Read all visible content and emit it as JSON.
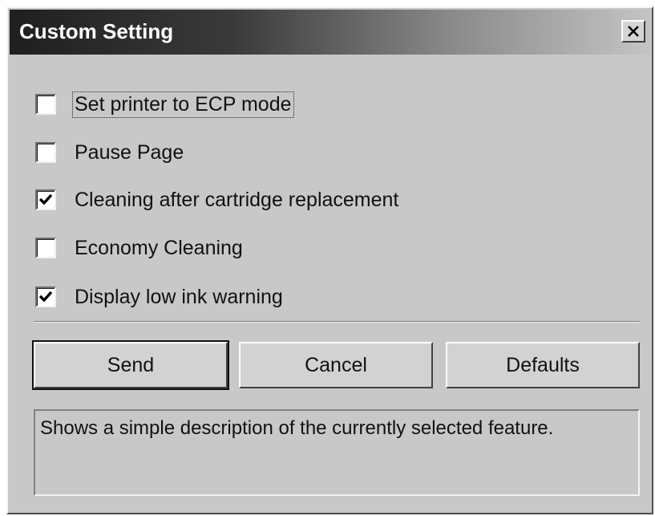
{
  "window": {
    "title": "Custom Setting",
    "close_label": "close"
  },
  "options": [
    {
      "label": "Set printer to ECP mode",
      "checked": false
    },
    {
      "label": "Pause Page",
      "checked": false
    },
    {
      "label": "Cleaning after cartridge replacement",
      "checked": true
    },
    {
      "label": "Economy Cleaning",
      "checked": false
    },
    {
      "label": "Display low ink warning",
      "checked": true
    }
  ],
  "buttons": {
    "send": "Send",
    "cancel": "Cancel",
    "defaults": "Defaults"
  },
  "description": "Shows a simple description of the currently selected feature.",
  "colors": {
    "dialog_bg": "#c8c8c8",
    "titlebar_dark": "#1f1f1f",
    "titlebar_light": "#c4c4c4"
  },
  "icons": {
    "close": "close-icon",
    "check": "checkmark-icon"
  }
}
